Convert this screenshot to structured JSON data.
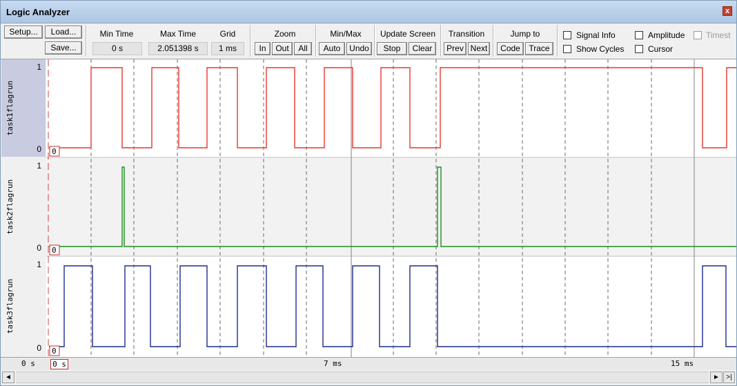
{
  "window": {
    "title": "Logic Analyzer",
    "close_glyph": "x"
  },
  "toolbar": {
    "setup_label": "Setup...",
    "load_label": "Load...",
    "save_label": "Save...",
    "min_time": {
      "label": "Min Time",
      "value": "0 s"
    },
    "max_time": {
      "label": "Max Time",
      "value": "2.051398 s"
    },
    "grid": {
      "label": "Grid",
      "value": "1 ms"
    },
    "zoom": {
      "label": "Zoom",
      "in": "In",
      "out": "Out",
      "all": "All"
    },
    "minmax": {
      "label": "Min/Max",
      "auto": "Auto",
      "undo": "Undo"
    },
    "update": {
      "label": "Update Screen",
      "stop": "Stop",
      "clear": "Clear"
    },
    "transition": {
      "label": "Transition",
      "prev": "Prev",
      "next": "Next"
    },
    "jump": {
      "label": "Jump to",
      "code": "Code",
      "trace": "Trace"
    },
    "options": {
      "signal_info": {
        "label": "Signal Info",
        "checked": false
      },
      "amplitude": {
        "label": "Amplitude",
        "checked": false
      },
      "timestamp": {
        "label": "Timest",
        "checked": false,
        "disabled": true
      },
      "show_cycles": {
        "label": "Show Cycles",
        "checked": false
      },
      "cursor": {
        "label": "Cursor",
        "checked": false
      }
    }
  },
  "signals": [
    {
      "name": "task1flagrun",
      "high": "1",
      "low": "0",
      "start_value": "0",
      "color": "#e8352e"
    },
    {
      "name": "task2flagrun",
      "high": "1",
      "low": "0",
      "start_value": "0",
      "color": "#1a8f1a"
    },
    {
      "name": "task3flagrun",
      "high": "1",
      "low": "0",
      "start_value": "0",
      "color": "#1c2a8c"
    }
  ],
  "axis": {
    "left_time": "0 s",
    "start_marker": "0 s",
    "ticks": [
      {
        "label": "7 ms",
        "ms": 7
      },
      {
        "label": "15 ms",
        "ms": 15
      }
    ]
  },
  "scroll": {
    "left_glyph": "◄",
    "right_glyph": "►",
    "end_glyph": ">|"
  }
}
